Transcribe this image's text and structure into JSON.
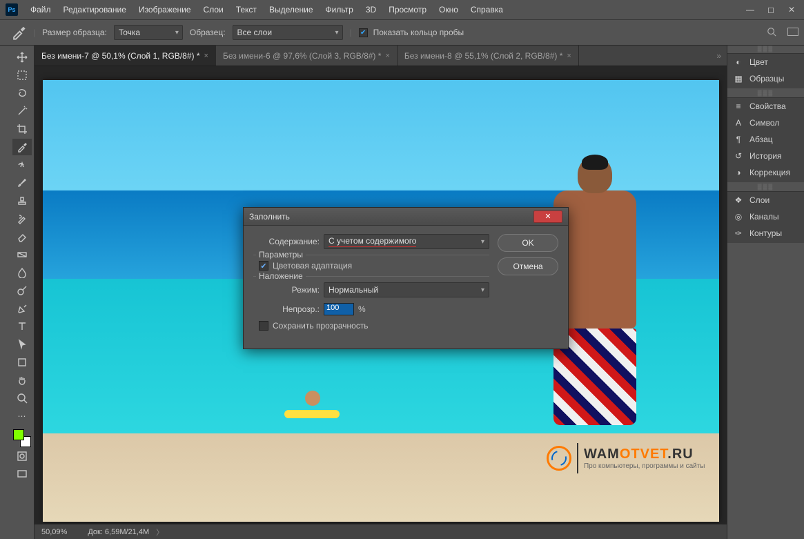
{
  "menubar": {
    "items": [
      "Файл",
      "Редактирование",
      "Изображение",
      "Слои",
      "Текст",
      "Выделение",
      "Фильтр",
      "3D",
      "Просмотр",
      "Окно",
      "Справка"
    ]
  },
  "optionsbar": {
    "sample_size_label": "Размер образца:",
    "sample_size_value": "Точка",
    "sample_label": "Образец:",
    "sample_value": "Все слои",
    "show_ring_label": "Показать кольцо пробы"
  },
  "doctabs": {
    "tabs": [
      {
        "label": "Без имени-7 @ 50,1% (Слой 1, RGB/8#) *"
      },
      {
        "label": "Без имени-6 @ 97,6% (Слой 3, RGB/8#) *"
      },
      {
        "label": "Без имени-8 @ 55,1% (Слой 2, RGB/8#) *"
      }
    ]
  },
  "statusbar": {
    "zoom": "50,09%",
    "doc": "Док: 6,59M/21,4M"
  },
  "right_panels": {
    "group1": [
      "Цвет",
      "Образцы"
    ],
    "group2": [
      "Свойства",
      "Символ",
      "Абзац",
      "История",
      "Коррекция"
    ],
    "group3": [
      "Слои",
      "Каналы",
      "Контуры"
    ]
  },
  "dialog": {
    "title": "Заполнить",
    "content_label": "Содержание:",
    "content_value": "С учетом содержимого",
    "ok": "OK",
    "cancel": "Отмена",
    "params_legend": "Параметры",
    "color_adapt": "Цветовая адаптация",
    "blend_legend": "Наложение",
    "mode_label": "Режим:",
    "mode_value": "Нормальный",
    "opacity_label": "Непрозр.:",
    "opacity_value": "100",
    "opacity_pct": "%",
    "preserve_trans": "Сохранить прозрачность"
  },
  "watermark": {
    "line1a": "WAM",
    "line1b": "OTVET",
    "line1c": ".RU",
    "line2": "Про компьютеры, программы и сайты"
  },
  "tools": [
    "move",
    "marquee",
    "lasso",
    "wand",
    "crop",
    "eyedropper",
    "heal",
    "brush",
    "stamp",
    "history-brush",
    "eraser",
    "gradient",
    "blur",
    "dodge",
    "pen",
    "type",
    "path-select",
    "rectangle",
    "hand",
    "zoom"
  ]
}
